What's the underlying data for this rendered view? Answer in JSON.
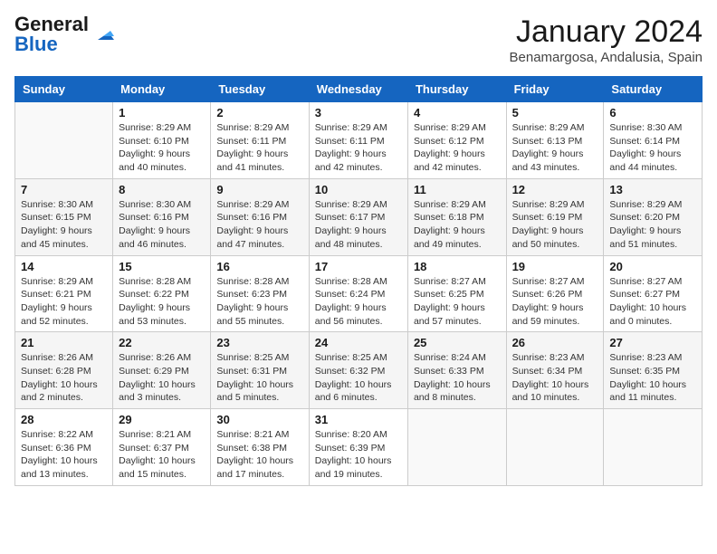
{
  "header": {
    "logo_line1": "General",
    "logo_line2": "Blue",
    "month_year": "January 2024",
    "location": "Benamargosa, Andalusia, Spain"
  },
  "days_of_week": [
    "Sunday",
    "Monday",
    "Tuesday",
    "Wednesday",
    "Thursday",
    "Friday",
    "Saturday"
  ],
  "weeks": [
    [
      {
        "num": "",
        "info": ""
      },
      {
        "num": "1",
        "info": "Sunrise: 8:29 AM\nSunset: 6:10 PM\nDaylight: 9 hours\nand 40 minutes."
      },
      {
        "num": "2",
        "info": "Sunrise: 8:29 AM\nSunset: 6:11 PM\nDaylight: 9 hours\nand 41 minutes."
      },
      {
        "num": "3",
        "info": "Sunrise: 8:29 AM\nSunset: 6:11 PM\nDaylight: 9 hours\nand 42 minutes."
      },
      {
        "num": "4",
        "info": "Sunrise: 8:29 AM\nSunset: 6:12 PM\nDaylight: 9 hours\nand 42 minutes."
      },
      {
        "num": "5",
        "info": "Sunrise: 8:29 AM\nSunset: 6:13 PM\nDaylight: 9 hours\nand 43 minutes."
      },
      {
        "num": "6",
        "info": "Sunrise: 8:30 AM\nSunset: 6:14 PM\nDaylight: 9 hours\nand 44 minutes."
      }
    ],
    [
      {
        "num": "7",
        "info": "Sunrise: 8:30 AM\nSunset: 6:15 PM\nDaylight: 9 hours\nand 45 minutes."
      },
      {
        "num": "8",
        "info": "Sunrise: 8:30 AM\nSunset: 6:16 PM\nDaylight: 9 hours\nand 46 minutes."
      },
      {
        "num": "9",
        "info": "Sunrise: 8:29 AM\nSunset: 6:16 PM\nDaylight: 9 hours\nand 47 minutes."
      },
      {
        "num": "10",
        "info": "Sunrise: 8:29 AM\nSunset: 6:17 PM\nDaylight: 9 hours\nand 48 minutes."
      },
      {
        "num": "11",
        "info": "Sunrise: 8:29 AM\nSunset: 6:18 PM\nDaylight: 9 hours\nand 49 minutes."
      },
      {
        "num": "12",
        "info": "Sunrise: 8:29 AM\nSunset: 6:19 PM\nDaylight: 9 hours\nand 50 minutes."
      },
      {
        "num": "13",
        "info": "Sunrise: 8:29 AM\nSunset: 6:20 PM\nDaylight: 9 hours\nand 51 minutes."
      }
    ],
    [
      {
        "num": "14",
        "info": "Sunrise: 8:29 AM\nSunset: 6:21 PM\nDaylight: 9 hours\nand 52 minutes."
      },
      {
        "num": "15",
        "info": "Sunrise: 8:28 AM\nSunset: 6:22 PM\nDaylight: 9 hours\nand 53 minutes."
      },
      {
        "num": "16",
        "info": "Sunrise: 8:28 AM\nSunset: 6:23 PM\nDaylight: 9 hours\nand 55 minutes."
      },
      {
        "num": "17",
        "info": "Sunrise: 8:28 AM\nSunset: 6:24 PM\nDaylight: 9 hours\nand 56 minutes."
      },
      {
        "num": "18",
        "info": "Sunrise: 8:27 AM\nSunset: 6:25 PM\nDaylight: 9 hours\nand 57 minutes."
      },
      {
        "num": "19",
        "info": "Sunrise: 8:27 AM\nSunset: 6:26 PM\nDaylight: 9 hours\nand 59 minutes."
      },
      {
        "num": "20",
        "info": "Sunrise: 8:27 AM\nSunset: 6:27 PM\nDaylight: 10 hours\nand 0 minutes."
      }
    ],
    [
      {
        "num": "21",
        "info": "Sunrise: 8:26 AM\nSunset: 6:28 PM\nDaylight: 10 hours\nand 2 minutes."
      },
      {
        "num": "22",
        "info": "Sunrise: 8:26 AM\nSunset: 6:29 PM\nDaylight: 10 hours\nand 3 minutes."
      },
      {
        "num": "23",
        "info": "Sunrise: 8:25 AM\nSunset: 6:31 PM\nDaylight: 10 hours\nand 5 minutes."
      },
      {
        "num": "24",
        "info": "Sunrise: 8:25 AM\nSunset: 6:32 PM\nDaylight: 10 hours\nand 6 minutes."
      },
      {
        "num": "25",
        "info": "Sunrise: 8:24 AM\nSunset: 6:33 PM\nDaylight: 10 hours\nand 8 minutes."
      },
      {
        "num": "26",
        "info": "Sunrise: 8:23 AM\nSunset: 6:34 PM\nDaylight: 10 hours\nand 10 minutes."
      },
      {
        "num": "27",
        "info": "Sunrise: 8:23 AM\nSunset: 6:35 PM\nDaylight: 10 hours\nand 11 minutes."
      }
    ],
    [
      {
        "num": "28",
        "info": "Sunrise: 8:22 AM\nSunset: 6:36 PM\nDaylight: 10 hours\nand 13 minutes."
      },
      {
        "num": "29",
        "info": "Sunrise: 8:21 AM\nSunset: 6:37 PM\nDaylight: 10 hours\nand 15 minutes."
      },
      {
        "num": "30",
        "info": "Sunrise: 8:21 AM\nSunset: 6:38 PM\nDaylight: 10 hours\nand 17 minutes."
      },
      {
        "num": "31",
        "info": "Sunrise: 8:20 AM\nSunset: 6:39 PM\nDaylight: 10 hours\nand 19 minutes."
      },
      {
        "num": "",
        "info": ""
      },
      {
        "num": "",
        "info": ""
      },
      {
        "num": "",
        "info": ""
      }
    ]
  ]
}
